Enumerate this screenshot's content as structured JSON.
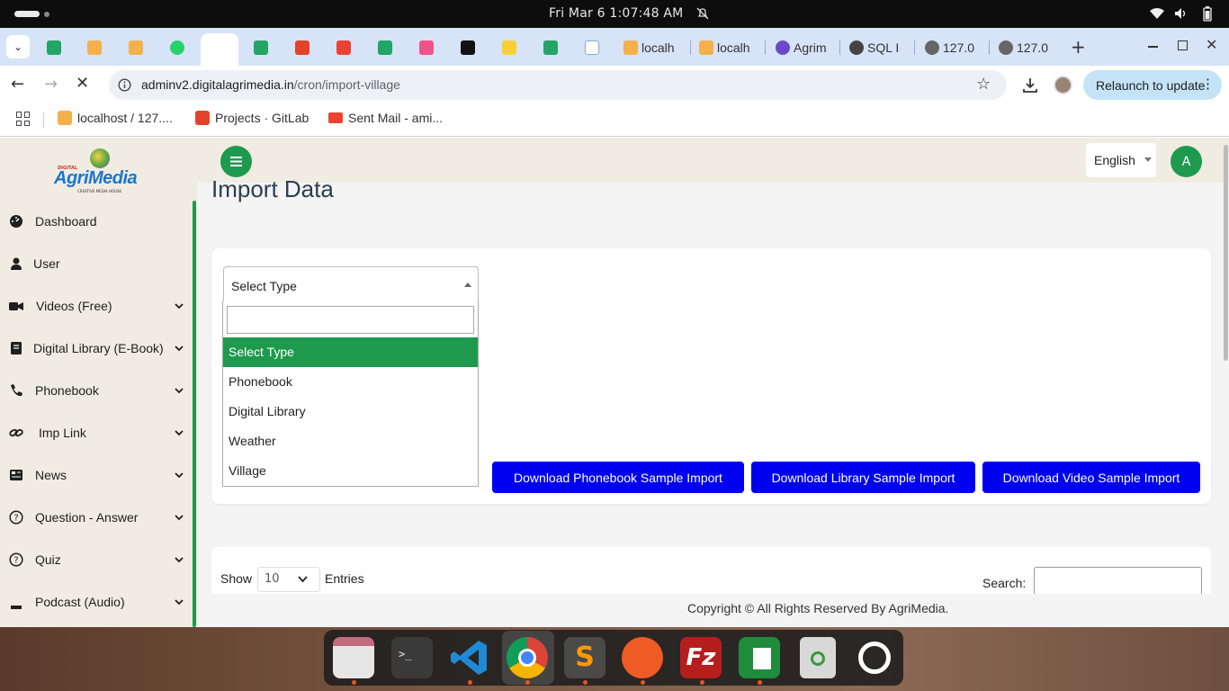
{
  "system": {
    "clock": "Fri Mar 6    1:07:48 AM"
  },
  "tabs": {
    "items": [
      {
        "label": "localh",
        "icon": "phpmyadmin-icon"
      },
      {
        "label": "localh",
        "icon": "phpmyadmin-icon"
      },
      {
        "label": "Agrim",
        "icon": "agrimedia-icon"
      },
      {
        "label": "SQL I",
        "icon": "chatgpt-icon"
      },
      {
        "label": "127.0",
        "icon": "globe-icon"
      },
      {
        "label": "127.0",
        "icon": "globe-icon"
      }
    ]
  },
  "browser": {
    "url_host": "adminv2.digitalagrimedia.in",
    "url_path": "/cron/import-village",
    "relaunch_label": "Relaunch to update"
  },
  "bookmarks": [
    {
      "label": "localhost / 127....",
      "icon": "phpmyadmin-icon"
    },
    {
      "label": "Projects · GitLab",
      "icon": "gitlab-icon"
    },
    {
      "label": "Sent Mail - ami...",
      "icon": "gmail-icon"
    }
  ],
  "sidebar": {
    "logo_small": "DIGITAL",
    "logo": "AgriMedia",
    "logo_tagline": "CREATIVE MEDIA HOUSE",
    "items": [
      {
        "label": "Dashboard",
        "icon": "dashboard-icon",
        "has_children": false
      },
      {
        "label": "User",
        "icon": "user-icon",
        "has_children": false
      },
      {
        "label": "Videos (Free)",
        "icon": "video-camera-icon",
        "has_children": true
      },
      {
        "label": "Digital Library (E-Book)",
        "icon": "book-icon",
        "has_children": true
      },
      {
        "label": "Phonebook",
        "icon": "phone-icon",
        "has_children": true
      },
      {
        "label": "Imp Link",
        "icon": "link-icon",
        "has_children": true
      },
      {
        "label": "News",
        "icon": "newspaper-icon",
        "has_children": true
      },
      {
        "label": "Question - Answer",
        "icon": "question-icon",
        "has_children": true
      },
      {
        "label": "Quiz",
        "icon": "question-icon",
        "has_children": true
      },
      {
        "label": "Podcast (Audio)",
        "icon": "podcast-icon",
        "has_children": true
      }
    ]
  },
  "header": {
    "language": "English",
    "avatar_letter": "A"
  },
  "main": {
    "title": "Import Data",
    "select": {
      "selected": "Select Type",
      "search_value": "",
      "options": [
        "Select Type",
        "Phonebook",
        "Digital Library",
        "Weather",
        "Village"
      ]
    },
    "buttons": {
      "phonebook": "Download Phonebook Sample Import",
      "library": "Download Library Sample Import",
      "video": "Download Video Sample Import"
    },
    "table": {
      "show_label": "Show",
      "entries_value": "10",
      "entries_label": "Entries",
      "search_label": "Search:"
    }
  },
  "footer": {
    "copyright": "Copyright © All Rights Reserved By AgriMedia."
  },
  "colors": {
    "accent": "#1d9a4d",
    "button_blue": "#0000f0",
    "sidebar_bg": "#f0ece1"
  },
  "dock": [
    "files-icon",
    "terminal-icon",
    "vscode-icon",
    "chrome-icon",
    "sublime-icon",
    "postman-icon",
    "filezilla-icon",
    "spreadsheet-icon",
    "trash-icon",
    "ubuntu-icon"
  ]
}
